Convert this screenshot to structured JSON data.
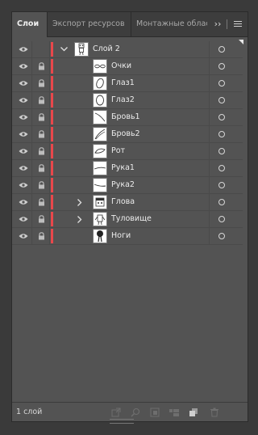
{
  "tabs": [
    {
      "label": "Слои"
    },
    {
      "label": "Экспорт ресурсов"
    },
    {
      "label": "Монтажные области"
    }
  ],
  "tab_overflow": "››",
  "layers": [
    {
      "name": "Слой 2",
      "expanded": true,
      "thumb": "figure"
    },
    {
      "name": "Очки",
      "thumb": "glasses"
    },
    {
      "name": "Глаз1",
      "thumb": "oval"
    },
    {
      "name": "Глаз2",
      "thumb": "oval"
    },
    {
      "name": "Бровь1",
      "thumb": "diag"
    },
    {
      "name": "Бровь2",
      "thumb": "diag2"
    },
    {
      "name": "Рот",
      "thumb": "mouth"
    },
    {
      "name": "Рука1",
      "thumb": "line"
    },
    {
      "name": "Рука2",
      "thumb": "line2"
    },
    {
      "name": "Глова",
      "expandable": true,
      "thumb": "head"
    },
    {
      "name": "Туловище",
      "expandable": true,
      "thumb": "body"
    },
    {
      "name": "Ноги",
      "thumb": "legs"
    }
  ],
  "footer": {
    "count": "1 слой"
  },
  "colors": {
    "layer_color": "#e8474b",
    "panel_bg": "#535353",
    "tabbar_bg": "#3d3d3d"
  }
}
